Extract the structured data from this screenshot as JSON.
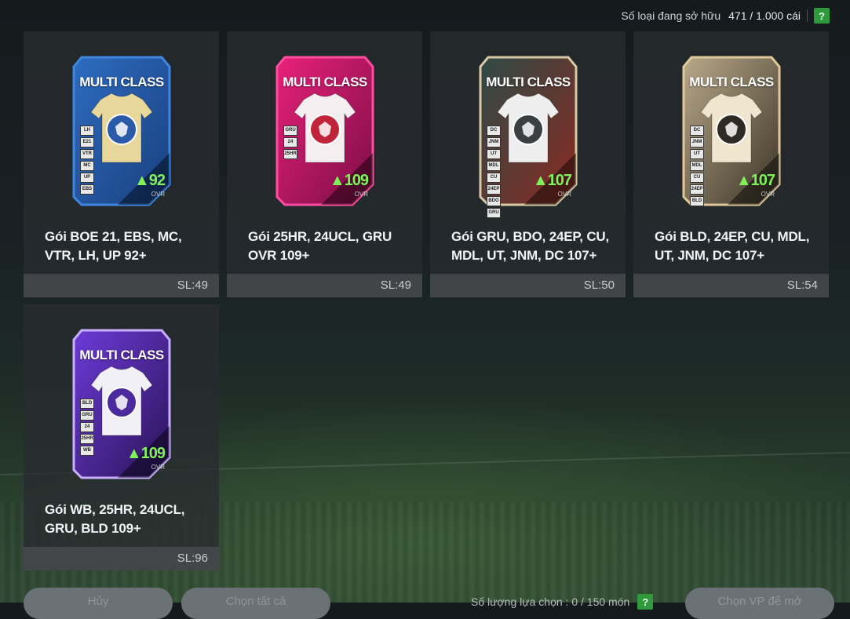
{
  "header": {
    "owned_label": "Số loại đang sở hữu",
    "owned_value": "471 / 1.000 cái",
    "help": "?"
  },
  "packs": [
    {
      "card_title": "MULTI CLASS",
      "rating": "92",
      "ovr": "OVR",
      "tags": [
        "LH",
        "E21",
        "VTR",
        "MC",
        "UP",
        "EBS"
      ],
      "name": "Gói BOE 21, EBS, MC, VTR, LH, UP 92+",
      "qty": "SL:49",
      "colors": {
        "bg1": "#2d6cc0",
        "bg2": "#1a3f7e",
        "frame": "#3f86e0",
        "shirt": "#e8d79a",
        "crest": "#2b5aa8"
      }
    },
    {
      "card_title": "MULTI CLASS",
      "rating": "109",
      "ovr": "OVR",
      "tags": [
        "GRU",
        "24",
        "25HR"
      ],
      "name": "Gói 25HR, 24UCL, GRU OVR 109+",
      "qty": "SL:49",
      "colors": {
        "bg1": "#e8217a",
        "bg2": "#7a0d45",
        "frame": "#ff4da0",
        "shirt": "#f4eef0",
        "crest": "#c0243a"
      }
    },
    {
      "card_title": "MULTI CLASS",
      "rating": "107",
      "ovr": "OVR",
      "tags": [
        "DC",
        "JNM",
        "UT",
        "MDL",
        "CU",
        "24EP",
        "BDO",
        "GRU"
      ],
      "name": "Gói GRU, BDO, 24EP, CU, MDL, UT, JNM, DC 107+",
      "qty": "SL:50",
      "colors": {
        "bg1": "#2e4a46",
        "bg2": "#8a2a22",
        "frame": "#d8c9a5",
        "shirt": "#eeeeee",
        "crest": "#3a3f42"
      }
    },
    {
      "card_title": "MULTI CLASS",
      "rating": "107",
      "ovr": "OVR",
      "tags": [
        "DC",
        "JNM",
        "UT",
        "MDL",
        "CU",
        "24EP",
        "BLD"
      ],
      "name": "Gói BLD, 24EP, CU, MDL, UT, JNM, DC 107+",
      "qty": "SL:54",
      "colors": {
        "bg1": "#b9a98a",
        "bg2": "#3a3326",
        "frame": "#e0c89a",
        "shirt": "#f0e6cf",
        "crest": "#2f2a23"
      }
    },
    {
      "card_title": "MULTI CLASS",
      "rating": "109",
      "ovr": "OVR",
      "tags": [
        "BLD",
        "GRU",
        "24",
        "25HR",
        "WB"
      ],
      "name": "Gói WB, 25HR, 24UCL, GRU, BLD 109+",
      "qty": "SL:96",
      "colors": {
        "bg1": "#6d3ad8",
        "bg2": "#2a1456",
        "frame": "#c9b0ff",
        "shirt": "#f2f0f7",
        "crest": "#4b2a9e"
      }
    }
  ],
  "footer": {
    "cancel": "Hủy",
    "select_all": "Chọn tất cả",
    "selected_label": "Số lượng lựa chọn : 0 / 150 món",
    "help": "?",
    "open_btn": "Chọn VP để mở"
  }
}
